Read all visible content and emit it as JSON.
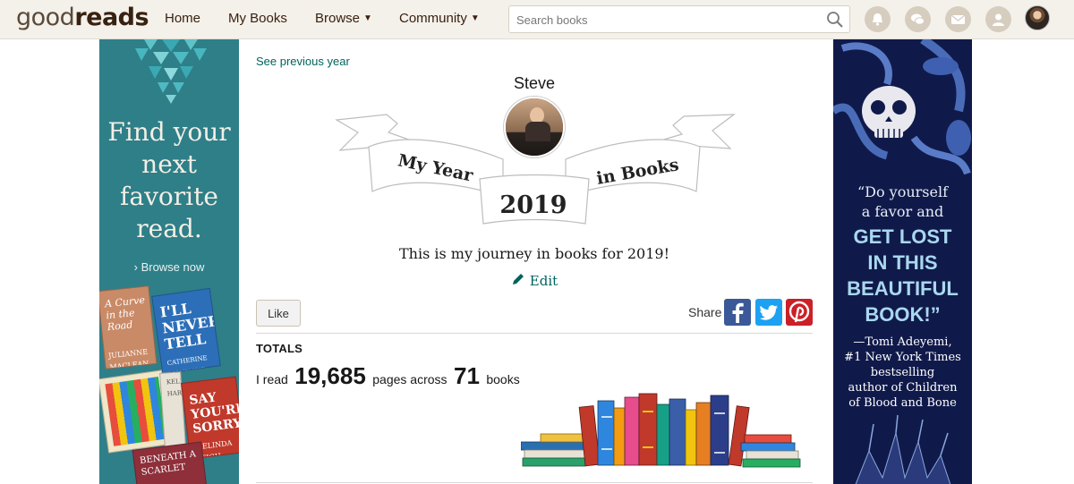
{
  "nav": {
    "logo_light": "good",
    "logo_bold": "reads",
    "home": "Home",
    "my_books": "My Books",
    "browse": "Browse",
    "community": "Community",
    "search_placeholder": "Search books"
  },
  "left_ad": {
    "headline": "Find your\nnext\nfavorite\nread.",
    "browse_link": "› Browse now",
    "book_texts": [
      "A Curve in the Road",
      "I'LL NEVER TELL",
      "JULIANNE MACLEAN",
      "CATHERINE MCKENZIE",
      "KELLY HARMS",
      "SAY YOU'RE SORRY",
      "BENEATH A SCARLET",
      "MELINDA LEIGH"
    ],
    "bg_color": "#2e7f88"
  },
  "right_ad": {
    "quote_intro": "“Do yourself\na favor and",
    "quote_main": "GET LOST\nIN THIS\nBEAUTIFUL\nBOOK!”",
    "attribution": "—Tomi Adeyemi,\n#1 New York Times\nbestselling\nauthor of Children\nof Blood and Bone",
    "bg_color": "#101a4a"
  },
  "main": {
    "see_previous": "See previous year",
    "username": "Steve",
    "banner_left": "My Year",
    "banner_right": "in Books",
    "year": "2019",
    "journey": "This is my journey in books for 2019!",
    "edit": "Edit",
    "like": "Like",
    "share": "Share",
    "totals_heading": "TOTALS",
    "stat_prefix": "I read",
    "pages": "19,685",
    "stat_mid": "pages across",
    "books": "71",
    "stat_suffix": "books"
  },
  "colors": {
    "nav_bg": "#f4f1ea",
    "link": "#00635d",
    "facebook": "#3b5998",
    "twitter": "#1da1f2",
    "pinterest": "#cb2027"
  },
  "icons": [
    "search-icon",
    "bell-icon",
    "chat-icon",
    "mail-icon",
    "friends-icon",
    "pencil-icon",
    "facebook-icon",
    "twitter-icon",
    "pinterest-icon"
  ]
}
